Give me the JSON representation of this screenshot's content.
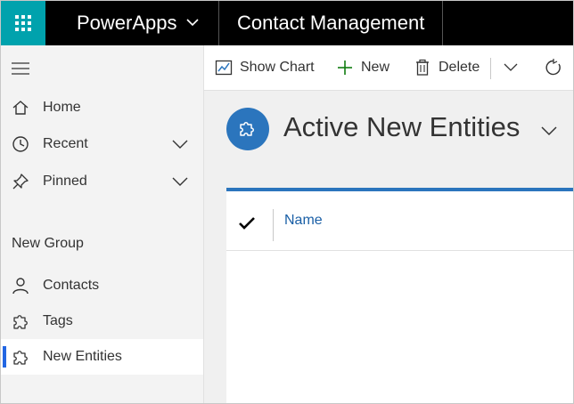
{
  "header": {
    "app_name": "PowerApps",
    "module_name": "Contact Management"
  },
  "sidebar": {
    "items": [
      {
        "label": "Home",
        "icon": "home-icon"
      },
      {
        "label": "Recent",
        "icon": "clock-icon",
        "expandable": true
      },
      {
        "label": "Pinned",
        "icon": "pin-icon",
        "expandable": true
      }
    ],
    "group_title": "New Group",
    "group_items": [
      {
        "label": "Contacts",
        "icon": "person-icon"
      },
      {
        "label": "Tags",
        "icon": "puzzle-icon"
      },
      {
        "label": "New Entities",
        "icon": "puzzle-icon",
        "selected": true
      }
    ]
  },
  "commandbar": {
    "show_chart": "Show Chart",
    "new": "New",
    "delete": "Delete"
  },
  "view": {
    "title": "Active New Entities"
  },
  "grid": {
    "columns": [
      "Name"
    ]
  },
  "colors": {
    "accent_teal": "#00a2ad",
    "brand_blue": "#2b75bd",
    "link_blue": "#1a5fa6",
    "selection_blue": "#2266e3"
  }
}
